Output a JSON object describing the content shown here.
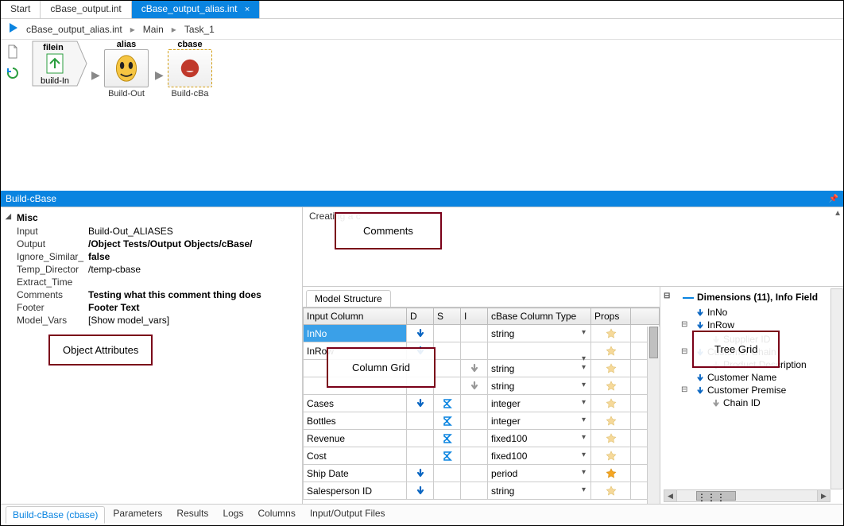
{
  "tabs": [
    {
      "label": "Start"
    },
    {
      "label": "cBase_output.int"
    },
    {
      "label": "cBase_output_alias.int",
      "close": "×"
    }
  ],
  "breadcrumb": {
    "file": "cBase_output_alias.int",
    "main": "Main",
    "task": "Task_1",
    "sep": "▸"
  },
  "nodes": {
    "filein": {
      "header": "filein",
      "footer": "build-In"
    },
    "alias": {
      "header": "alias",
      "footer": "Build-Out"
    },
    "cbase": {
      "header": "cbase",
      "footer": "Build-cBa"
    }
  },
  "panel_title": "Build-cBase",
  "props": {
    "group": "Misc",
    "rows": [
      {
        "label": "Input",
        "value": "Build-Out_ALIASES",
        "bold": false
      },
      {
        "label": "Output",
        "value": "/Object Tests/Output Objects/cBase/",
        "bold": true
      },
      {
        "label": "Ignore_Similar_",
        "value": "false",
        "bold": true
      },
      {
        "label": "Temp_Director",
        "value": "/temp-cbase",
        "bold": false
      },
      {
        "label": "Extract_Time",
        "value": "",
        "bold": false
      },
      {
        "label": "Comments",
        "value": "Testing what this comment thing does",
        "bold": true
      },
      {
        "label": "Footer",
        "value": "Footer Text",
        "bold": true
      },
      {
        "label": "Model_Vars",
        "value": "[Show model_vars]",
        "bold": false
      }
    ]
  },
  "callouts": {
    "object_attributes": "Object Attributes",
    "comments": "Comments",
    "column_grid": "Column Grid",
    "tree_grid": "Tree Grid"
  },
  "comments_text": "Creating a c",
  "model_tab": "Model Structure",
  "grid": {
    "headers": [
      "Input Column",
      "D",
      "S",
      "I",
      "cBase Column Type",
      "Props",
      ""
    ],
    "rows": [
      {
        "name": "InNo",
        "d": "down",
        "s": "",
        "i": "",
        "type": "string",
        "prop": "star-light",
        "sel": true
      },
      {
        "name": "InRow",
        "d": "down",
        "s": "",
        "i": "",
        "type": "",
        "prop": "star-light"
      },
      {
        "name": "",
        "d": "",
        "s": "",
        "i": "gray",
        "type": "string",
        "prop": "star-light"
      },
      {
        "name": "",
        "d": "",
        "s": "",
        "i": "gray",
        "type": "string",
        "prop": "star-light"
      },
      {
        "name": "Cases",
        "d": "down",
        "s": "sigma",
        "i": "",
        "type": "integer",
        "prop": "star-light"
      },
      {
        "name": "Bottles",
        "d": "",
        "s": "sigma",
        "i": "",
        "type": "integer",
        "prop": "star-light"
      },
      {
        "name": "Revenue",
        "d": "",
        "s": "sigma",
        "i": "",
        "type": "fixed100",
        "prop": "star-light"
      },
      {
        "name": "Cost",
        "d": "",
        "s": "sigma",
        "i": "",
        "type": "fixed100",
        "prop": "star-light"
      },
      {
        "name": "Ship Date",
        "d": "down",
        "s": "",
        "i": "",
        "type": "period",
        "prop": "star"
      },
      {
        "name": "Salesperson ID",
        "d": "down",
        "s": "",
        "i": "",
        "type": "string",
        "prop": "star-light"
      }
    ]
  },
  "tree": {
    "header": "Dimensions (11), Info Field",
    "items": [
      {
        "icon": "down",
        "label": "InNo",
        "level": 1
      },
      {
        "icon": "down",
        "label": "InRow",
        "level": 1,
        "exp": "⊟"
      },
      {
        "icon": "",
        "label": "",
        "level": 2
      },
      {
        "icon": "gray",
        "label": "Supplier ID",
        "level": 2
      },
      {
        "icon": "down",
        "label": "Customer Chain",
        "level": 1,
        "exp": "⊟"
      },
      {
        "icon": "gray",
        "label": "Product Description",
        "level": 2
      },
      {
        "icon": "down",
        "label": "Customer Name",
        "level": 1
      },
      {
        "icon": "down",
        "label": "Customer Premise",
        "level": 1,
        "exp": "⊟"
      },
      {
        "icon": "gray",
        "label": "Chain ID",
        "level": 2
      }
    ]
  },
  "bottom_tabs": [
    {
      "label": "Build-cBase (cbase)",
      "active": true
    },
    {
      "label": "Parameters"
    },
    {
      "label": "Results"
    },
    {
      "label": "Logs"
    },
    {
      "label": "Columns"
    },
    {
      "label": "Input/Output Files"
    }
  ]
}
